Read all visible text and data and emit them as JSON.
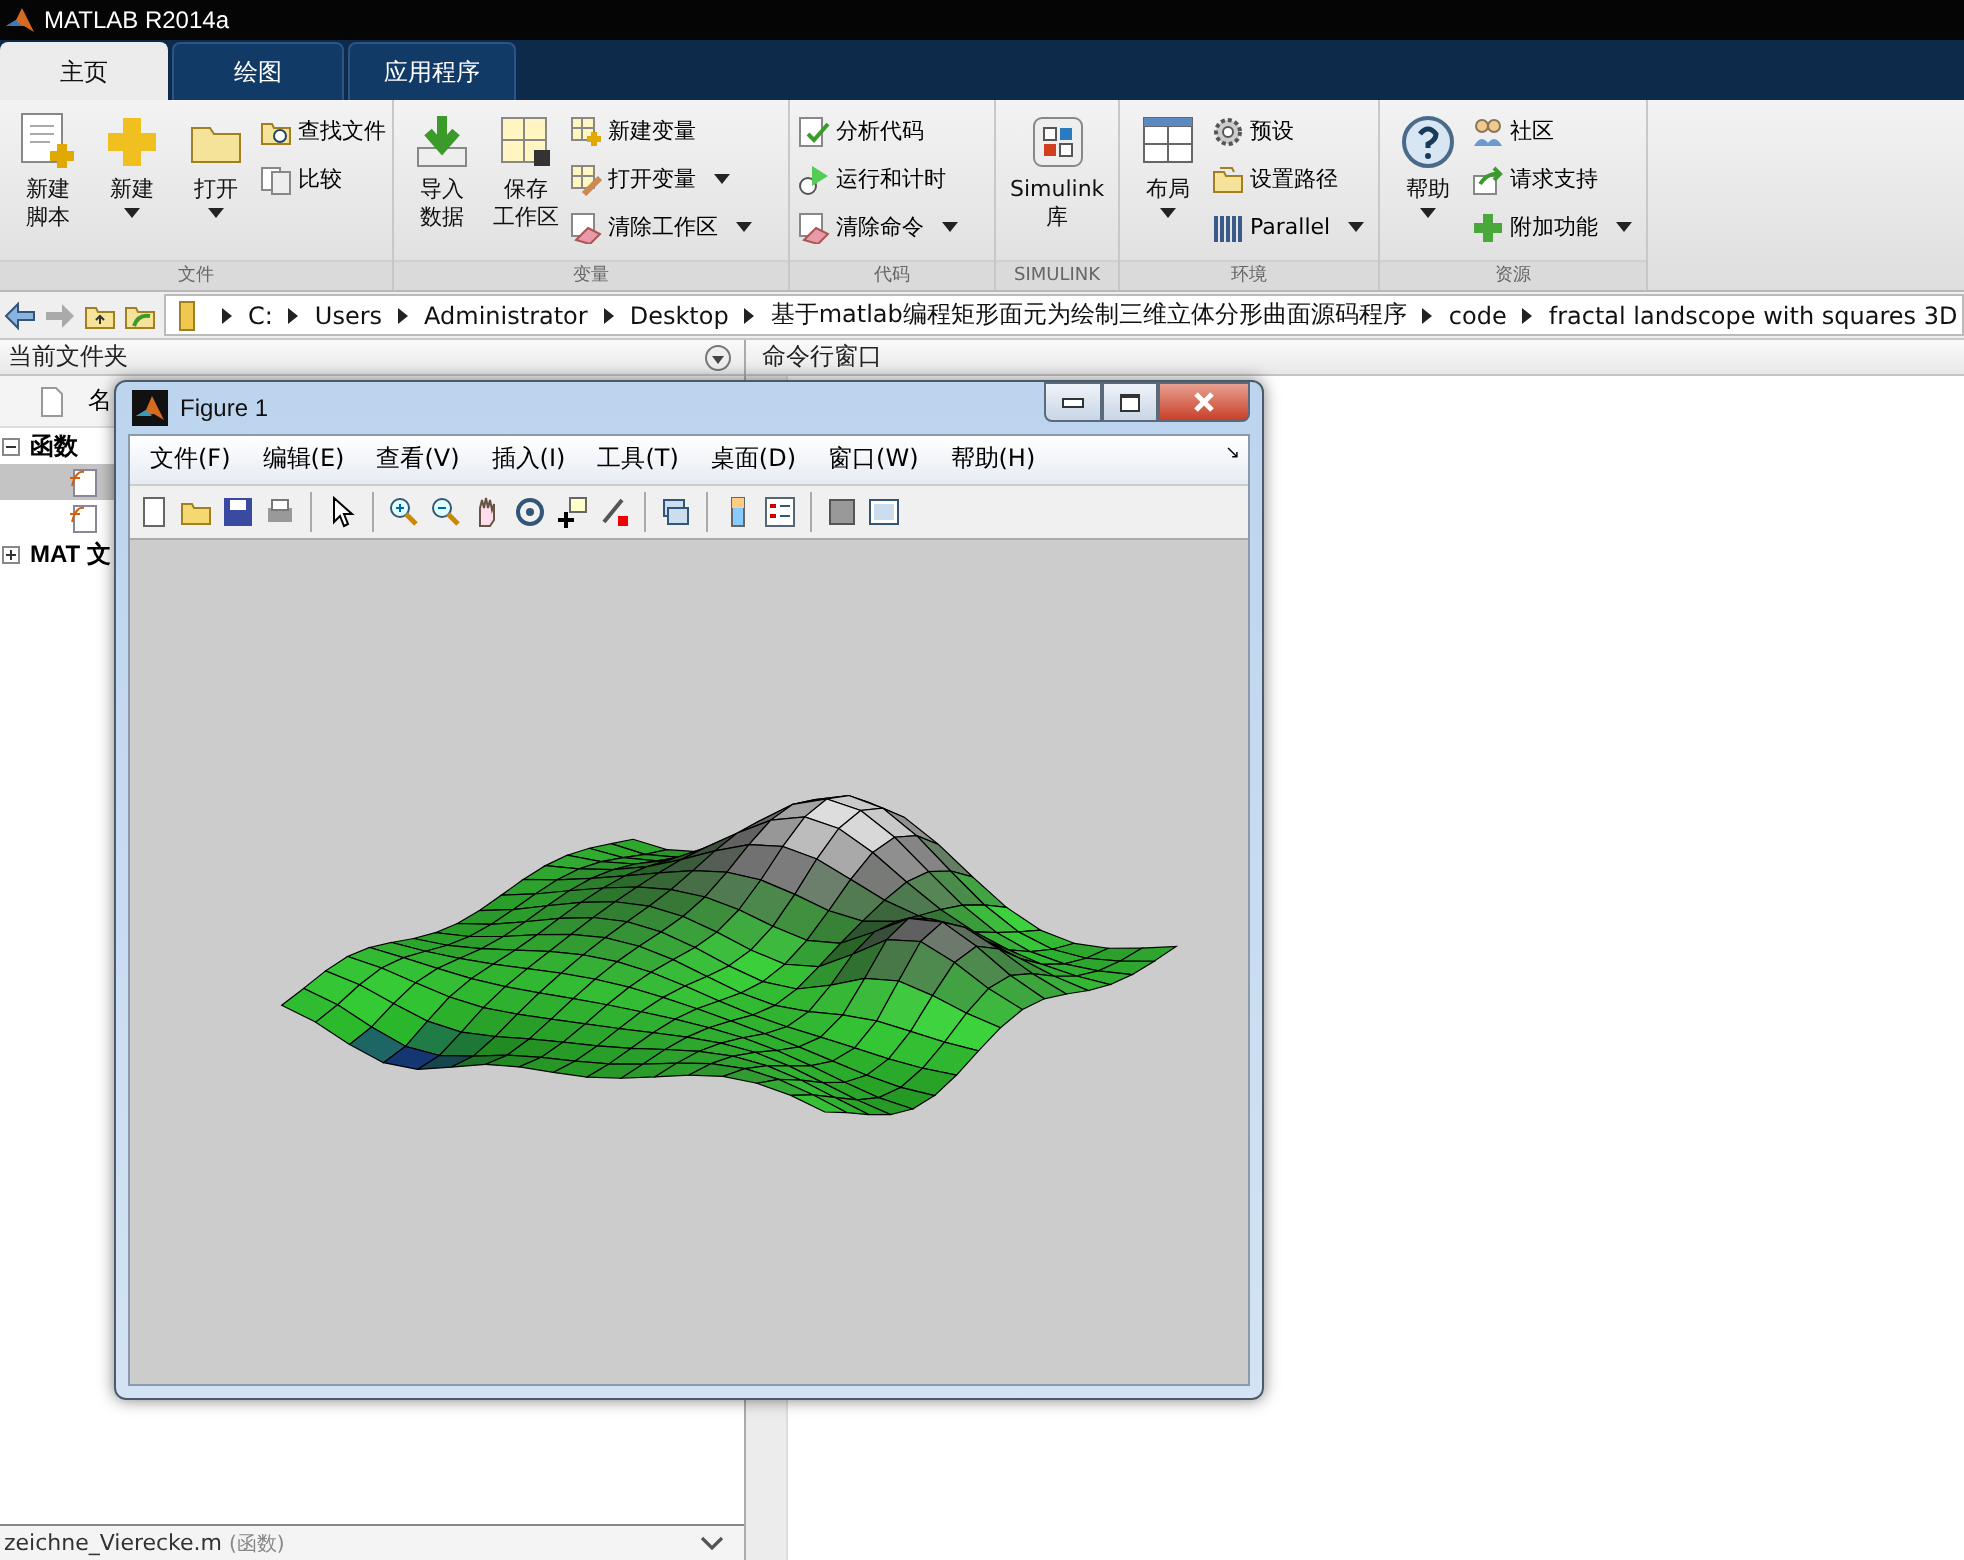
{
  "app_title": "MATLAB R2014a",
  "tabs": [
    {
      "label": "主页",
      "selected": true
    },
    {
      "label": "绘图",
      "selected": false
    },
    {
      "label": "应用程序",
      "selected": false
    }
  ],
  "ribbon": {
    "sections": [
      {
        "label": "文件",
        "items": [
          {
            "kind": "large",
            "lines": [
              "新建",
              "脚本"
            ],
            "dropdown": false
          },
          {
            "kind": "large",
            "lines": [
              "新建"
            ],
            "dropdown": true
          },
          {
            "kind": "large",
            "lines": [
              "打开"
            ],
            "dropdown": true
          },
          {
            "kind": "small",
            "label": "查找文件",
            "dropdown": false
          },
          {
            "kind": "small",
            "label": "比较",
            "dropdown": false
          }
        ]
      },
      {
        "label": "变量",
        "items": [
          {
            "kind": "large",
            "lines": [
              "导入",
              "数据"
            ],
            "dropdown": false
          },
          {
            "kind": "large",
            "lines": [
              "保存",
              "工作区"
            ],
            "dropdown": false
          },
          {
            "kind": "small",
            "label": "新建变量",
            "dropdown": false
          },
          {
            "kind": "small",
            "label": "打开变量",
            "dropdown": true
          },
          {
            "kind": "small",
            "label": "清除工作区",
            "dropdown": true
          }
        ]
      },
      {
        "label": "代码",
        "items": [
          {
            "kind": "small",
            "label": "分析代码",
            "dropdown": false
          },
          {
            "kind": "small",
            "label": "运行和计时",
            "dropdown": false
          },
          {
            "kind": "small",
            "label": "清除命令",
            "dropdown": true
          }
        ]
      },
      {
        "label": "SIMULINK",
        "items": [
          {
            "kind": "large",
            "lines": [
              "Simulink",
              "库"
            ],
            "dropdown": false
          }
        ]
      },
      {
        "label": "环境",
        "items": [
          {
            "kind": "large",
            "lines": [
              "布局"
            ],
            "dropdown": true
          },
          {
            "kind": "small",
            "label": "预设",
            "dropdown": false
          },
          {
            "kind": "small",
            "label": "设置路径",
            "dropdown": false
          },
          {
            "kind": "small",
            "label": "Parallel",
            "dropdown": true
          }
        ]
      },
      {
        "label": "资源",
        "items": [
          {
            "kind": "large",
            "lines": [
              "帮助"
            ],
            "dropdown": true
          },
          {
            "kind": "small",
            "label": "社区",
            "dropdown": false
          },
          {
            "kind": "small",
            "label": "请求支持",
            "dropdown": false
          },
          {
            "kind": "small",
            "label": "附加功能",
            "dropdown": true
          }
        ]
      }
    ]
  },
  "address_bar": {
    "path": [
      "C:",
      "Users",
      "Administrator",
      "Desktop",
      "基于matlab编程矩形面元为绘制三维立体分形曲面源码程序",
      "code",
      "fractal landscope with squares 3D"
    ]
  },
  "current_folder": {
    "title": "当前文件夹",
    "column_1": "名",
    "tree": [
      {
        "label": "函数",
        "expanded": true,
        "children": [
          {
            "selected": true
          },
          {
            "selected": false
          }
        ]
      },
      {
        "label": "MAT 文",
        "expanded": false
      }
    ],
    "details": {
      "name": "zeichne_Vierecke.m",
      "type": "(函数)"
    }
  },
  "command_window": {
    "title": "命令行窗口"
  },
  "figure": {
    "title": "Figure 1",
    "menus": [
      "文件(F)",
      "编辑(E)",
      "查看(V)",
      "插入(I)",
      "工具(T)",
      "桌面(D)",
      "窗口(W)",
      "帮助(H)"
    ],
    "menu_caret": "↘"
  }
}
